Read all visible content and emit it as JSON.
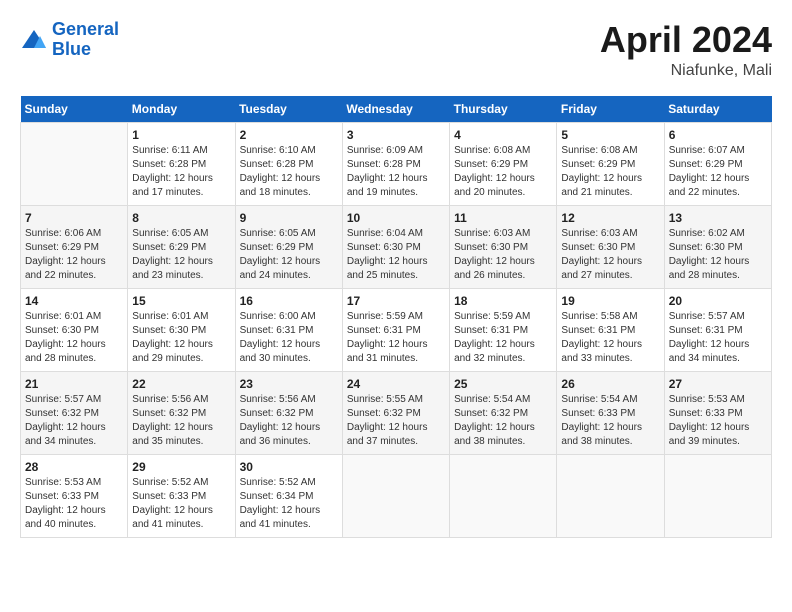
{
  "header": {
    "logo_line1": "General",
    "logo_line2": "Blue",
    "month": "April 2024",
    "location": "Niafunke, Mali"
  },
  "days_of_week": [
    "Sunday",
    "Monday",
    "Tuesday",
    "Wednesday",
    "Thursday",
    "Friday",
    "Saturday"
  ],
  "weeks": [
    [
      {
        "day": "",
        "info": ""
      },
      {
        "day": "1",
        "info": "Sunrise: 6:11 AM\nSunset: 6:28 PM\nDaylight: 12 hours\nand 17 minutes."
      },
      {
        "day": "2",
        "info": "Sunrise: 6:10 AM\nSunset: 6:28 PM\nDaylight: 12 hours\nand 18 minutes."
      },
      {
        "day": "3",
        "info": "Sunrise: 6:09 AM\nSunset: 6:28 PM\nDaylight: 12 hours\nand 19 minutes."
      },
      {
        "day": "4",
        "info": "Sunrise: 6:08 AM\nSunset: 6:29 PM\nDaylight: 12 hours\nand 20 minutes."
      },
      {
        "day": "5",
        "info": "Sunrise: 6:08 AM\nSunset: 6:29 PM\nDaylight: 12 hours\nand 21 minutes."
      },
      {
        "day": "6",
        "info": "Sunrise: 6:07 AM\nSunset: 6:29 PM\nDaylight: 12 hours\nand 22 minutes."
      }
    ],
    [
      {
        "day": "7",
        "info": "Sunrise: 6:06 AM\nSunset: 6:29 PM\nDaylight: 12 hours\nand 22 minutes."
      },
      {
        "day": "8",
        "info": "Sunrise: 6:05 AM\nSunset: 6:29 PM\nDaylight: 12 hours\nand 23 minutes."
      },
      {
        "day": "9",
        "info": "Sunrise: 6:05 AM\nSunset: 6:29 PM\nDaylight: 12 hours\nand 24 minutes."
      },
      {
        "day": "10",
        "info": "Sunrise: 6:04 AM\nSunset: 6:30 PM\nDaylight: 12 hours\nand 25 minutes."
      },
      {
        "day": "11",
        "info": "Sunrise: 6:03 AM\nSunset: 6:30 PM\nDaylight: 12 hours\nand 26 minutes."
      },
      {
        "day": "12",
        "info": "Sunrise: 6:03 AM\nSunset: 6:30 PM\nDaylight: 12 hours\nand 27 minutes."
      },
      {
        "day": "13",
        "info": "Sunrise: 6:02 AM\nSunset: 6:30 PM\nDaylight: 12 hours\nand 28 minutes."
      }
    ],
    [
      {
        "day": "14",
        "info": "Sunrise: 6:01 AM\nSunset: 6:30 PM\nDaylight: 12 hours\nand 28 minutes."
      },
      {
        "day": "15",
        "info": "Sunrise: 6:01 AM\nSunset: 6:30 PM\nDaylight: 12 hours\nand 29 minutes."
      },
      {
        "day": "16",
        "info": "Sunrise: 6:00 AM\nSunset: 6:31 PM\nDaylight: 12 hours\nand 30 minutes."
      },
      {
        "day": "17",
        "info": "Sunrise: 5:59 AM\nSunset: 6:31 PM\nDaylight: 12 hours\nand 31 minutes."
      },
      {
        "day": "18",
        "info": "Sunrise: 5:59 AM\nSunset: 6:31 PM\nDaylight: 12 hours\nand 32 minutes."
      },
      {
        "day": "19",
        "info": "Sunrise: 5:58 AM\nSunset: 6:31 PM\nDaylight: 12 hours\nand 33 minutes."
      },
      {
        "day": "20",
        "info": "Sunrise: 5:57 AM\nSunset: 6:31 PM\nDaylight: 12 hours\nand 34 minutes."
      }
    ],
    [
      {
        "day": "21",
        "info": "Sunrise: 5:57 AM\nSunset: 6:32 PM\nDaylight: 12 hours\nand 34 minutes."
      },
      {
        "day": "22",
        "info": "Sunrise: 5:56 AM\nSunset: 6:32 PM\nDaylight: 12 hours\nand 35 minutes."
      },
      {
        "day": "23",
        "info": "Sunrise: 5:56 AM\nSunset: 6:32 PM\nDaylight: 12 hours\nand 36 minutes."
      },
      {
        "day": "24",
        "info": "Sunrise: 5:55 AM\nSunset: 6:32 PM\nDaylight: 12 hours\nand 37 minutes."
      },
      {
        "day": "25",
        "info": "Sunrise: 5:54 AM\nSunset: 6:32 PM\nDaylight: 12 hours\nand 38 minutes."
      },
      {
        "day": "26",
        "info": "Sunrise: 5:54 AM\nSunset: 6:33 PM\nDaylight: 12 hours\nand 38 minutes."
      },
      {
        "day": "27",
        "info": "Sunrise: 5:53 AM\nSunset: 6:33 PM\nDaylight: 12 hours\nand 39 minutes."
      }
    ],
    [
      {
        "day": "28",
        "info": "Sunrise: 5:53 AM\nSunset: 6:33 PM\nDaylight: 12 hours\nand 40 minutes."
      },
      {
        "day": "29",
        "info": "Sunrise: 5:52 AM\nSunset: 6:33 PM\nDaylight: 12 hours\nand 41 minutes."
      },
      {
        "day": "30",
        "info": "Sunrise: 5:52 AM\nSunset: 6:34 PM\nDaylight: 12 hours\nand 41 minutes."
      },
      {
        "day": "",
        "info": ""
      },
      {
        "day": "",
        "info": ""
      },
      {
        "day": "",
        "info": ""
      },
      {
        "day": "",
        "info": ""
      }
    ]
  ]
}
